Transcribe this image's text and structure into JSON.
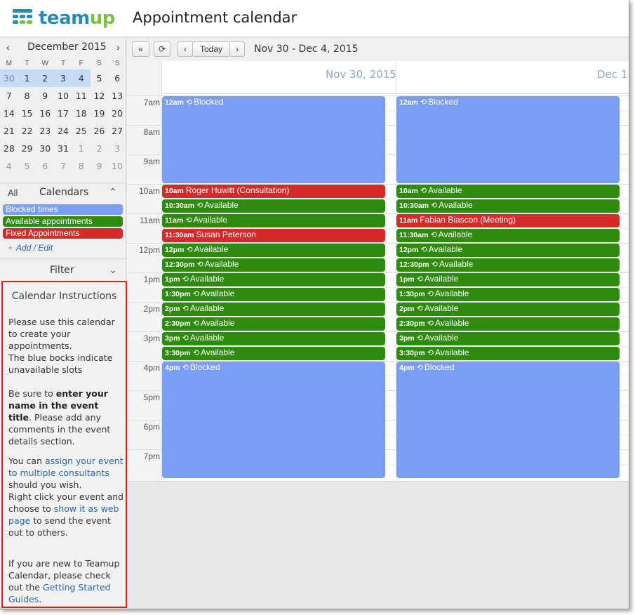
{
  "header": {
    "logo_text_a": "team",
    "logo_text_b": "up",
    "logo_colors": [
      "#2b8ab4",
      "#7cc242"
    ],
    "title": "Appointment calendar"
  },
  "mini_calendar": {
    "prev_icon": "chevron-left-icon",
    "next_icon": "chevron-right-icon",
    "prev": "‹",
    "next": "›",
    "month": "December 2015",
    "dow": [
      "M",
      "T",
      "W",
      "T",
      "F",
      "S",
      "S"
    ],
    "weeks": [
      [
        "30",
        "1",
        "2",
        "3",
        "4",
        "5",
        "6"
      ],
      [
        "7",
        "8",
        "9",
        "10",
        "11",
        "12",
        "13"
      ],
      [
        "14",
        "15",
        "16",
        "17",
        "18",
        "19",
        "20"
      ],
      [
        "21",
        "22",
        "23",
        "24",
        "25",
        "26",
        "27"
      ],
      [
        "28",
        "29",
        "30",
        "31",
        "1",
        "2",
        "3"
      ],
      [
        "4",
        "5",
        "6",
        "7",
        "8",
        "9",
        "10"
      ]
    ],
    "selected_color": "#c7dbf5"
  },
  "calendars": {
    "all_label": "All",
    "title": "Calendars",
    "toggle": "⌃",
    "items": [
      {
        "label": "Blocked times",
        "color": "#7b9ef5"
      },
      {
        "label": "Available appointments",
        "color": "#2e8b0e"
      },
      {
        "label": "Fixed Appointments",
        "color": "#d42a2a"
      }
    ],
    "add_plus": "+",
    "add_edit": "Add / Edit"
  },
  "filter": {
    "label": "Filter",
    "toggle": "⌄"
  },
  "instructions": {
    "title": "Calendar Instructions",
    "p1": "Please use this calendar to create your appointments.",
    "p1b": "The blue bocks indicate unavailable slots",
    "p2_a": "Be sure to ",
    "p2_b": "enter your name in the event title",
    "p2_c": ". Please add any comments in the event details section.",
    "p3_a": "You can ",
    "p3_link1": "assign your event to multiple consultants",
    "p3_b": " should you wish.",
    "p3_c": "Right click your event and choose to ",
    "p3_link2": "show it as web page",
    "p3_d": " to send the event out to others.",
    "p4_a": "If you are new to Teamup Calendar, please check out the ",
    "p4_link": "Getting Started Guides",
    "p4_b": ".",
    "border_color": "#e02020"
  },
  "toolbar": {
    "back_icon": "double-chevron-left-icon",
    "back": "«",
    "refresh_icon": "refresh-icon",
    "refresh": "⟳",
    "prev": "‹",
    "today": "Today",
    "next": "›",
    "range": "Nov 30 - Dec 4, 2015"
  },
  "days": [
    "Nov 30, 2015",
    "Dec 1"
  ],
  "time_labels": [
    "7am",
    "8am",
    "9am",
    "10am",
    "11am",
    "12pm",
    "1pm",
    "2pm",
    "3pm",
    "4pm",
    "5pm",
    "6pm",
    "7pm"
  ],
  "event_colors": {
    "blocked": "#7b9ef5",
    "available": "#2e8b0e",
    "fixed": "#d42a2a"
  },
  "recurring_icon": "recurring-icon",
  "recurring_glyph": "⟲",
  "events": [
    [
      {
        "time": "12am",
        "title": "Blocked",
        "kind": "blocked",
        "recurring": true,
        "start": 7,
        "end": 10
      },
      {
        "time": "10am",
        "title": "Roger Huwitt (Consultation)",
        "kind": "fixed",
        "recurring": false,
        "start": 10,
        "end": 10.5
      },
      {
        "time": "10:30am",
        "title": "Available",
        "kind": "available",
        "recurring": true,
        "start": 10.5,
        "end": 11
      },
      {
        "time": "11am",
        "title": "Available",
        "kind": "available",
        "recurring": true,
        "start": 11,
        "end": 11.5
      },
      {
        "time": "11:30am",
        "title": "Susan Peterson",
        "kind": "fixed",
        "recurring": false,
        "start": 11.5,
        "end": 12
      },
      {
        "time": "12pm",
        "title": "Available",
        "kind": "available",
        "recurring": true,
        "start": 12,
        "end": 12.5
      },
      {
        "time": "12:30pm",
        "title": "Available",
        "kind": "available",
        "recurring": true,
        "start": 12.5,
        "end": 13
      },
      {
        "time": "1pm",
        "title": "Available",
        "kind": "available",
        "recurring": true,
        "start": 13,
        "end": 13.5
      },
      {
        "time": "1:30pm",
        "title": "Available",
        "kind": "available",
        "recurring": true,
        "start": 13.5,
        "end": 14
      },
      {
        "time": "2pm",
        "title": "Available",
        "kind": "available",
        "recurring": true,
        "start": 14,
        "end": 14.5
      },
      {
        "time": "2:30pm",
        "title": "Available",
        "kind": "available",
        "recurring": true,
        "start": 14.5,
        "end": 15
      },
      {
        "time": "3pm",
        "title": "Available",
        "kind": "available",
        "recurring": true,
        "start": 15,
        "end": 15.5
      },
      {
        "time": "3:30pm",
        "title": "Available",
        "kind": "available",
        "recurring": true,
        "start": 15.5,
        "end": 16
      },
      {
        "time": "4pm",
        "title": "Blocked",
        "kind": "blocked",
        "recurring": true,
        "start": 16,
        "end": 20
      }
    ],
    [
      {
        "time": "12am",
        "title": "Blocked",
        "kind": "blocked",
        "recurring": true,
        "start": 7,
        "end": 10
      },
      {
        "time": "10am",
        "title": "Available",
        "kind": "available",
        "recurring": true,
        "start": 10,
        "end": 10.5
      },
      {
        "time": "10:30am",
        "title": "Available",
        "kind": "available",
        "recurring": true,
        "start": 10.5,
        "end": 11
      },
      {
        "time": "11am",
        "title": "Fabian Biascon (Meeting)",
        "kind": "fixed",
        "recurring": false,
        "start": 11,
        "end": 11.5
      },
      {
        "time": "11:30am",
        "title": "Available",
        "kind": "available",
        "recurring": true,
        "start": 11.5,
        "end": 12
      },
      {
        "time": "12pm",
        "title": "Available",
        "kind": "available",
        "recurring": true,
        "start": 12,
        "end": 12.5
      },
      {
        "time": "12:30pm",
        "title": "Available",
        "kind": "available",
        "recurring": true,
        "start": 12.5,
        "end": 13
      },
      {
        "time": "1pm",
        "title": "Available",
        "kind": "available",
        "recurring": true,
        "start": 13,
        "end": 13.5
      },
      {
        "time": "1:30pm",
        "title": "Available",
        "kind": "available",
        "recurring": true,
        "start": 13.5,
        "end": 14
      },
      {
        "time": "2pm",
        "title": "Available",
        "kind": "available",
        "recurring": true,
        "start": 14,
        "end": 14.5
      },
      {
        "time": "2:30pm",
        "title": "Available",
        "kind": "available",
        "recurring": true,
        "start": 14.5,
        "end": 15
      },
      {
        "time": "3pm",
        "title": "Available",
        "kind": "available",
        "recurring": true,
        "start": 15,
        "end": 15.5
      },
      {
        "time": "3:30pm",
        "title": "Available",
        "kind": "available",
        "recurring": true,
        "start": 15.5,
        "end": 16
      },
      {
        "time": "4pm",
        "title": "Blocked",
        "kind": "blocked",
        "recurring": true,
        "start": 16,
        "end": 20
      }
    ]
  ]
}
